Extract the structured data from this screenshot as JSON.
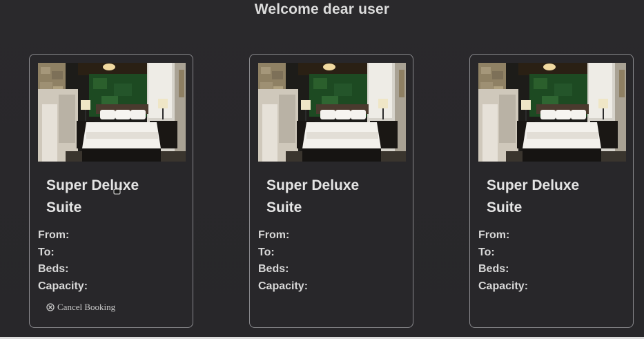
{
  "header": {
    "welcome": "Welcome dear user"
  },
  "cards": [
    {
      "title": "Super Deluxe Suite",
      "from_label": "From:",
      "to_label": "To:",
      "beds_label": "Beds:",
      "capacity_label": "Capacity:",
      "cancel_label": "Cancel Booking"
    },
    {
      "title": "Super Deluxe Suite",
      "from_label": "From:",
      "to_label": "To:",
      "beds_label": "Beds:",
      "capacity_label": "Capacity:"
    },
    {
      "title": "Super Deluxe Suite",
      "from_label": "From:",
      "to_label": "To:",
      "beds_label": "Beds:",
      "capacity_label": "Capacity:"
    }
  ],
  "icons": {
    "cancel": "circle-x-icon"
  },
  "colors": {
    "background": "#29282b",
    "card_border": "#8a8a8e",
    "text": "#e4e4e4"
  }
}
